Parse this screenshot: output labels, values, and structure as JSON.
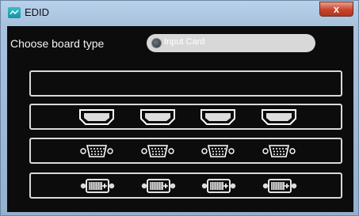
{
  "window": {
    "title": "EDID",
    "close_symbol": "x",
    "app_icon": "app-icon"
  },
  "board": {
    "label": "Choose board type",
    "selected_value": "Input Card"
  },
  "panels": [
    {
      "name": "empty-panel",
      "ports": []
    },
    {
      "name": "hdmi-panel",
      "port_icon": "hdmi-port-icon",
      "ports": 4
    },
    {
      "name": "vga-panel",
      "port_icon": "vga-port-icon",
      "ports": 4
    },
    {
      "name": "dvi-panel",
      "port_icon": "dvi-port-icon",
      "ports": 4
    }
  ],
  "colors": {
    "background": "#0c0c0d",
    "border": "#d9d9d9",
    "select_bg": "#d8d8d8",
    "close_button": "#c8432b"
  }
}
